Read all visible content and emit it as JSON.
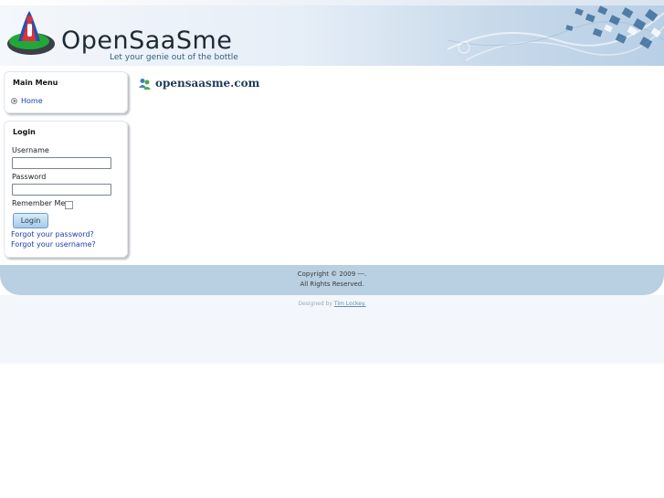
{
  "header": {
    "site_title": "OpenSaaSme",
    "tagline": "Let your genie out of the bottle",
    "logo_icon": "genie-logo-icon"
  },
  "main_menu": {
    "title": "Main Menu",
    "items": [
      {
        "label": "Home",
        "icon": "bullet-arrow-icon"
      }
    ]
  },
  "login": {
    "title": "Login",
    "username_label": "Username",
    "username_value": "",
    "password_label": "Password",
    "password_value": "",
    "remember_label": "Remember Me",
    "remember_checked": false,
    "button_label": "Login",
    "forgot_password": "Forgot your password?",
    "forgot_username": "Forgot your username?"
  },
  "content": {
    "title": "opensaasme.com",
    "title_icon": "users-icon"
  },
  "footer": {
    "copyright": "Copyright © 2009 ---.",
    "rights": "All Rights Reserved.",
    "designed_by_prefix": "Designed by",
    "designer_name": "Tim Lockey."
  },
  "colors": {
    "link": "#1f3cae",
    "header_accent": "#b8cfe6",
    "footer_band": "#b9cfe2",
    "button_fill": "#a6cbe8"
  }
}
